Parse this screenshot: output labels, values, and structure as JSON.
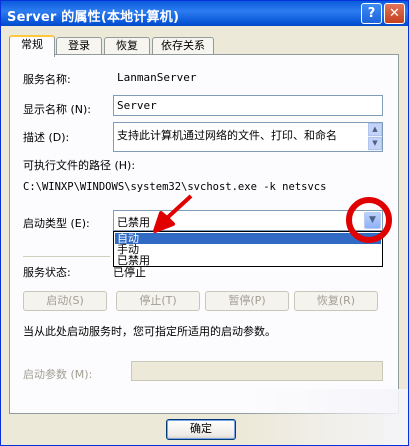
{
  "window": {
    "title": "Server 的属性(本地计算机)",
    "help_glyph": "?",
    "close_glyph": "✕"
  },
  "tabs": [
    {
      "label": "常规"
    },
    {
      "label": "登录"
    },
    {
      "label": "恢复"
    },
    {
      "label": "依存关系"
    }
  ],
  "general": {
    "service_name_label": "服务名称:",
    "service_name_value": "LanmanServer",
    "display_name_label": "显示名称 (N):",
    "display_name_value": "Server",
    "description_label": "描述 (D):",
    "description_value": "支持此计算机通过网络的文件、打印、和命名",
    "exe_path_label": "可执行文件的路径 (H):",
    "exe_path_value": "C:\\WINXP\\WINDOWS\\system32\\svchost.exe -k netsvcs",
    "startup_type_label": "启动类型 (E):",
    "startup_type_value": "已禁用",
    "startup_options": [
      "自动",
      "手动",
      "已禁用"
    ],
    "service_status_label": "服务状态:",
    "service_status_value": "已停止",
    "buttons": {
      "start": "启动(S)",
      "stop": "停止(T)",
      "pause": "暂停(P)",
      "resume": "恢复(R)"
    },
    "hint_text": "当从此处启动服务时，您可指定所适用的启动参数。",
    "start_params_label": "启动参数 (M):",
    "start_params_value": ""
  },
  "footer": {
    "ok_label": "确定"
  },
  "colors": {
    "titlebar": "#0553d6",
    "highlight_annotation": "#e00000",
    "selection": "#316ac5"
  }
}
